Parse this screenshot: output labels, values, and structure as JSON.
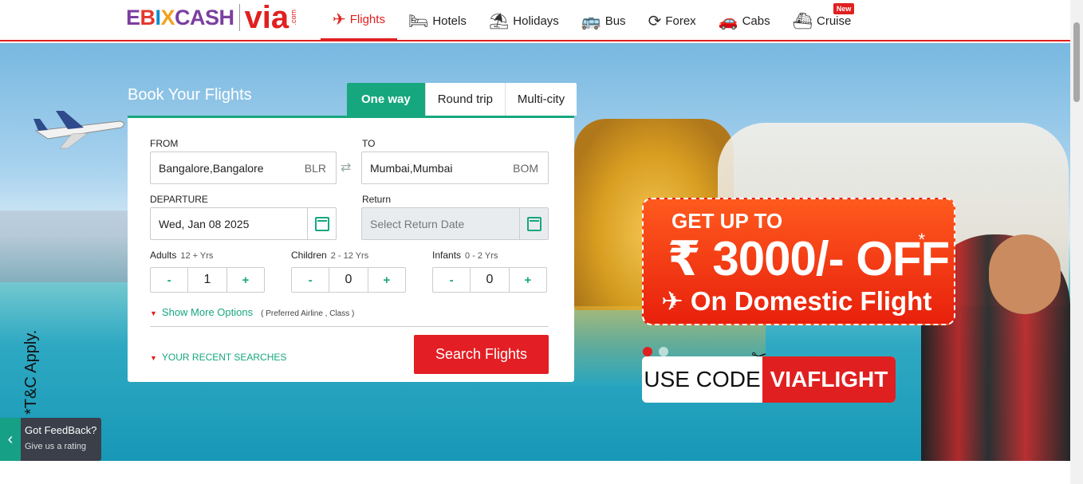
{
  "header": {
    "logo_ebix": [
      "E",
      "B",
      "I",
      "X",
      "CASH"
    ],
    "logo_via": "via",
    "logo_com": ".com",
    "nav": [
      {
        "label": "Flights",
        "icon": "plane-icon",
        "glyph": "✈"
      },
      {
        "label": "Hotels",
        "icon": "bed-icon",
        "glyph": "🛏"
      },
      {
        "label": "Holidays",
        "icon": "beach-icon",
        "glyph": "⛱"
      },
      {
        "label": "Bus",
        "icon": "bus-icon",
        "glyph": "🚌"
      },
      {
        "label": "Forex",
        "icon": "forex-icon",
        "glyph": "⟳"
      },
      {
        "label": "Cabs",
        "icon": "car-icon",
        "glyph": "🚗"
      },
      {
        "label": "Cruise",
        "icon": "ship-icon",
        "glyph": "⛴"
      }
    ],
    "new_badge": "New"
  },
  "search": {
    "title": "Book Your Flights",
    "tabs": [
      "One way",
      "Round trip",
      "Multi-city"
    ],
    "from_label": "FROM",
    "from_value": "Bangalore,Bangalore",
    "from_code": "BLR",
    "to_label": "TO",
    "to_value": "Mumbai,Mumbai",
    "to_code": "BOM",
    "departure_label": "DEPARTURE",
    "departure_value": "Wed, Jan 08 2025",
    "return_label": "Return",
    "return_placeholder": "Select Return Date",
    "adults_label": "Adults",
    "adults_range": "12 + Yrs",
    "adults_value": "1",
    "children_label": "Children",
    "children_range": "2 - 12 Yrs",
    "children_value": "0",
    "infants_label": "Infants",
    "infants_range": "0 - 2 Yrs",
    "infants_value": "0",
    "minus": "-",
    "plus": "+",
    "more_options": "Show More Options",
    "more_hint": "( Preferred Airline , Class )",
    "recent": "YOUR RECENT SEARCHES",
    "button": "Search Flights"
  },
  "promo": {
    "line1": "GET UP TO",
    "line2": "₹ 3000/- OFF",
    "asterisk": "*",
    "line3": "✈ On Domestic Flight",
    "use_code": "USE CODE",
    "code": "VIAFLIGHT",
    "tc": "*T&C Apply."
  },
  "feedback": {
    "arrow": "‹",
    "title": "Got FeedBack?",
    "subtitle": "Give us a rating"
  },
  "colors": {
    "brand_red": "#e02020",
    "accent_green": "#17a77e"
  }
}
